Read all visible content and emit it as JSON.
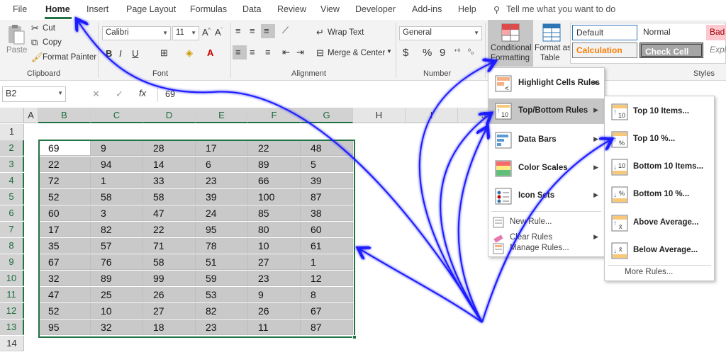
{
  "menubar": {
    "tabs": [
      "File",
      "Home",
      "Insert",
      "Page Layout",
      "Formulas",
      "Data",
      "Review",
      "View",
      "Developer",
      "Add-ins",
      "Help"
    ],
    "tell_me": "Tell me what you want to do"
  },
  "clipboard": {
    "paste": "Paste",
    "cut": "Cut",
    "copy": "Copy",
    "format_painter": "Format Painter",
    "group": "Clipboard"
  },
  "font": {
    "name": "Calibri",
    "size": "11",
    "bold": "B",
    "italic": "I",
    "underline": "U",
    "group": "Font"
  },
  "alignment": {
    "wrap": "Wrap Text",
    "merge": "Merge & Center",
    "group": "Alignment"
  },
  "number": {
    "format": "General",
    "currency": "$",
    "percent": "%",
    "comma": "9",
    "group": "Number"
  },
  "styles_group": {
    "cond_fmt_line1": "Conditional",
    "cond_fmt_line2": "Formatting",
    "fmt_table_line1": "Format as",
    "fmt_table_line2": "Table",
    "default": "Default",
    "normal": "Normal",
    "bad": "Bad",
    "calculation": "Calculation",
    "check_cell": "Check Cell",
    "explanatory": "Expl",
    "group": "Styles",
    "colors": {
      "bad_bg": "#ffc7ce",
      "bad_fg": "#9c0006",
      "calc_fg": "#fa7d00",
      "check_bg": "#a5a5a5"
    }
  },
  "formula_bar": {
    "name_box": "B2",
    "fx": "fx",
    "value": "69"
  },
  "sheet": {
    "columns": [
      "A",
      "B",
      "C",
      "D",
      "E",
      "F",
      "G",
      "H",
      "I",
      "J"
    ],
    "rows": [
      "1",
      "2",
      "3",
      "4",
      "5",
      "6",
      "7",
      "8",
      "9",
      "10",
      "11",
      "12",
      "13",
      "14"
    ],
    "data": [
      [
        "69",
        "9",
        "28",
        "17",
        "22",
        "48"
      ],
      [
        "22",
        "94",
        "14",
        "6",
        "89",
        "5"
      ],
      [
        "72",
        "1",
        "33",
        "23",
        "66",
        "39"
      ],
      [
        "52",
        "58",
        "58",
        "39",
        "100",
        "87"
      ],
      [
        "60",
        "3",
        "47",
        "24",
        "85",
        "38"
      ],
      [
        "17",
        "82",
        "22",
        "95",
        "80",
        "60"
      ],
      [
        "35",
        "57",
        "71",
        "78",
        "10",
        "61"
      ],
      [
        "67",
        "76",
        "58",
        "51",
        "27",
        "1"
      ],
      [
        "32",
        "89",
        "99",
        "59",
        "23",
        "12"
      ],
      [
        "47",
        "25",
        "26",
        "53",
        "9",
        "8"
      ],
      [
        "52",
        "10",
        "27",
        "82",
        "26",
        "67"
      ],
      [
        "95",
        "32",
        "18",
        "23",
        "11",
        "87"
      ]
    ],
    "selection_color": "#217346"
  },
  "cf_menu": {
    "items": [
      "Highlight Cells Rules",
      "Top/Bottom Rules",
      "Data Bars",
      "Color Scales",
      "Icon Sets"
    ],
    "small_items": [
      "New Rule...",
      "Clear Rules",
      "Manage Rules..."
    ]
  },
  "topbottom_menu": {
    "items": [
      "Top 10 Items...",
      "Top 10 %...",
      "Bottom 10 Items...",
      "Bottom 10 %...",
      "Above Average...",
      "Below Average..."
    ],
    "more": "More Rules..."
  },
  "annotation_color": "#1a1aff"
}
